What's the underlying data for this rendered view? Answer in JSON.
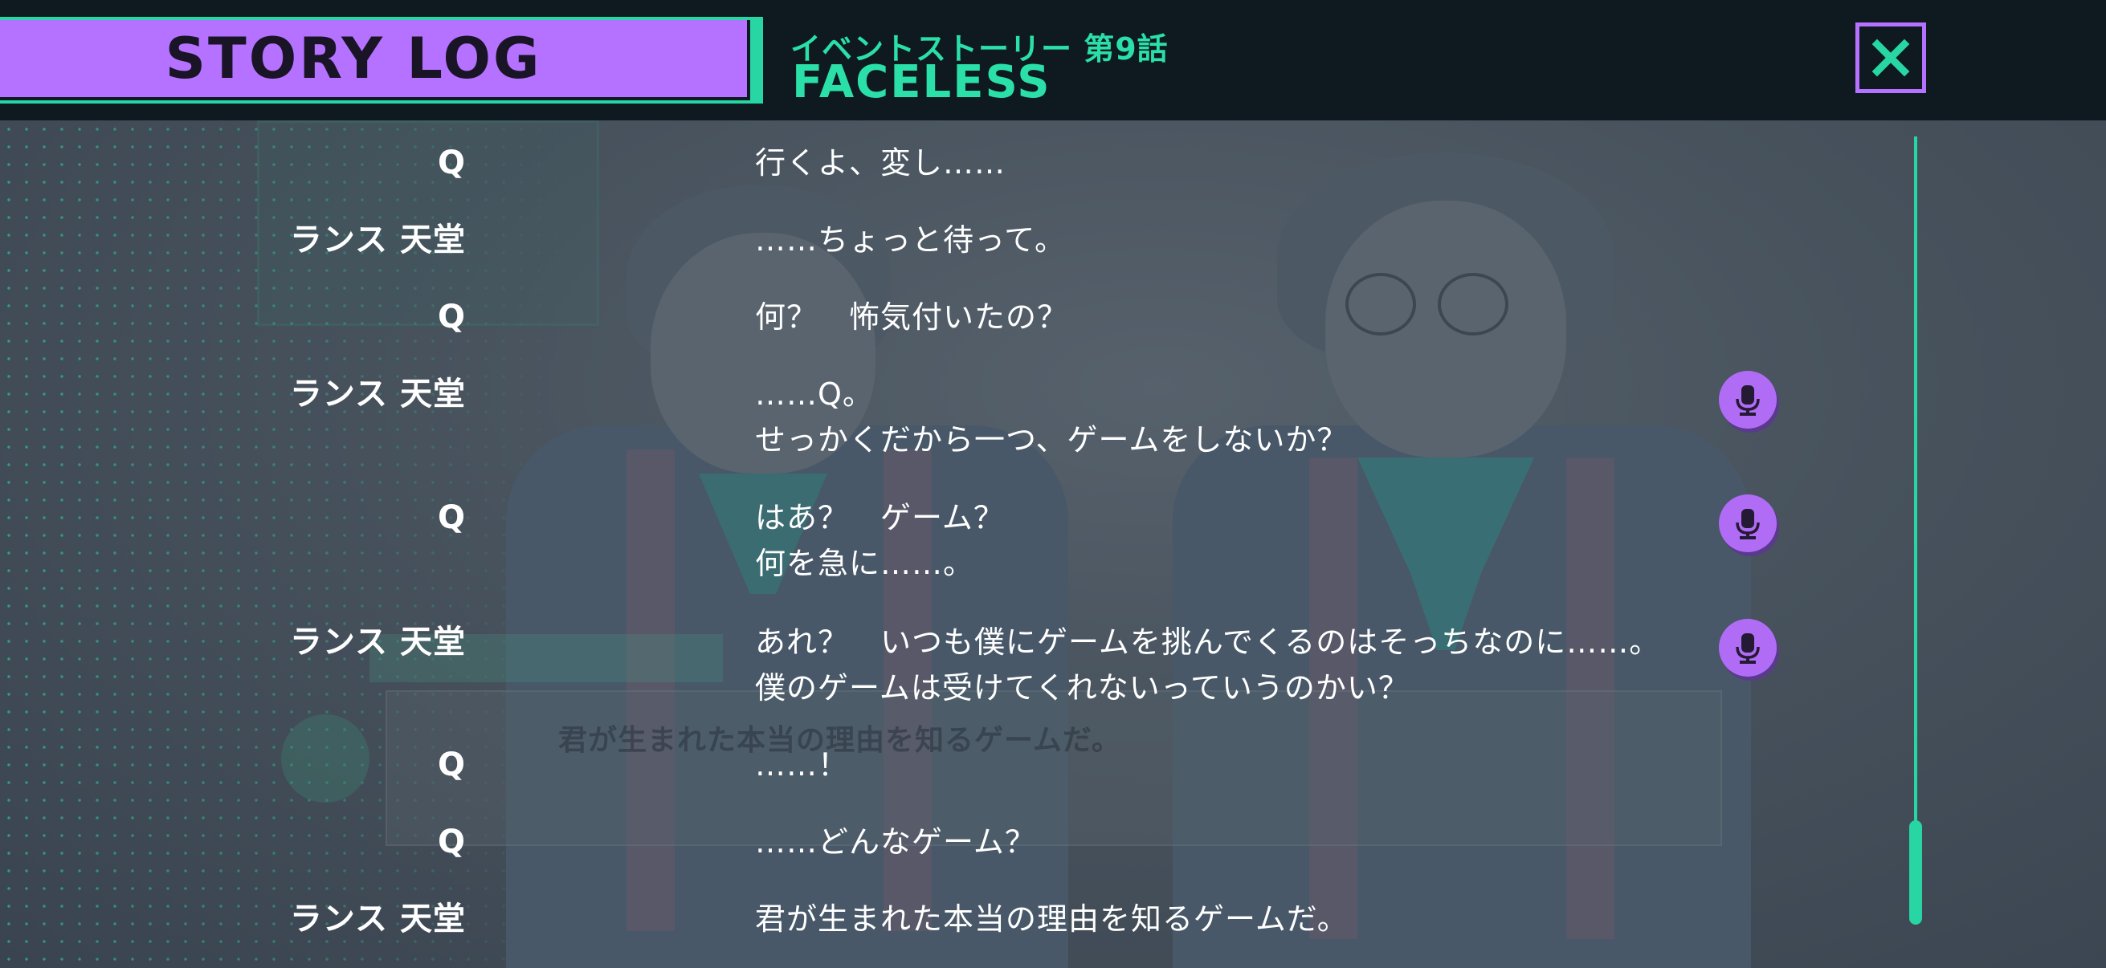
{
  "header": {
    "title": "STORY LOG",
    "subtitle": "イベントストーリー 第9話",
    "episode": "FACELESS",
    "close_icon": "close-icon"
  },
  "entries": [
    {
      "speaker": "Q",
      "lines": [
        "行くよ、変し……"
      ],
      "voice": false
    },
    {
      "speaker": "ランス 天堂",
      "lines": [
        "……ちょっと待って。"
      ],
      "voice": false
    },
    {
      "speaker": "Q",
      "lines": [
        "何？　怖気付いたの？"
      ],
      "voice": false
    },
    {
      "speaker": "ランス 天堂",
      "lines": [
        "……Q。",
        "せっかくだから一つ、ゲームをしないか？"
      ],
      "voice": true
    },
    {
      "speaker": "Q",
      "lines": [
        "はあ？　ゲーム？",
        "何を急に……。"
      ],
      "voice": true
    },
    {
      "speaker": "ランス 天堂",
      "lines": [
        "あれ？　いつも僕にゲームを挑んでくるのはそっちなのに……。",
        "僕のゲームは受けてくれないっていうのかい？"
      ],
      "voice": true
    },
    {
      "speaker": "Q",
      "lines": [
        "……！"
      ],
      "voice": false
    },
    {
      "speaker": "Q",
      "lines": [
        "……どんなゲーム？"
      ],
      "voice": false
    },
    {
      "speaker": "ランス 天堂",
      "lines": [
        "君が生まれた本当の理由を知るゲームだ。"
      ],
      "voice": false
    }
  ],
  "background": {
    "dialog_text": "君が生まれた本当の理由を知るゲームだ。"
  },
  "icons": {
    "voice": "microphone-icon"
  },
  "colors": {
    "accent_green": "#28d6a4",
    "accent_purple": "#b571ff",
    "header_bg": "#0e1920"
  }
}
